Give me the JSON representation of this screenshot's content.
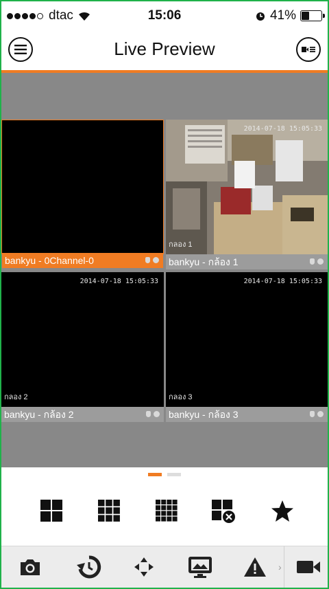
{
  "status": {
    "carrier": "dtac",
    "time": "15:06",
    "battery": "41%",
    "battery_level": 0.41
  },
  "header": {
    "title": "Live Preview"
  },
  "tiles": [
    {
      "label": "bankyu - 0Channel-0",
      "timestamp": "",
      "osd": "",
      "active": true
    },
    {
      "label": "bankyu - กล้อง 1",
      "timestamp": "2014-07-18 15:05:33",
      "osd": "กลอง 1",
      "active": false
    },
    {
      "label": "bankyu - กล้อง 2",
      "timestamp": "2014-07-18 15:05:33",
      "osd": "กลอง 2",
      "active": false
    },
    {
      "label": "bankyu - กล้อง 3",
      "timestamp": "2014-07-18 15:05:33",
      "osd": "กลอง 3",
      "active": false
    }
  ],
  "pager": {
    "pages": 2,
    "current": 1
  },
  "layout_icons": [
    "grid-2x2-icon",
    "grid-3x3-icon",
    "grid-4x4-icon",
    "close-all-icon",
    "favorite-star-icon"
  ],
  "toolbar_icons": [
    "snapshot-camera-icon",
    "playback-history-icon",
    "ptz-arrows-icon",
    "screen-display-icon",
    "alarm-warning-icon",
    "record-video-icon"
  ],
  "colors": {
    "accent": "#f07c23",
    "tile_bar": "#9c9c9c",
    "background_gray": "#888888",
    "border": "#1fb24a"
  }
}
